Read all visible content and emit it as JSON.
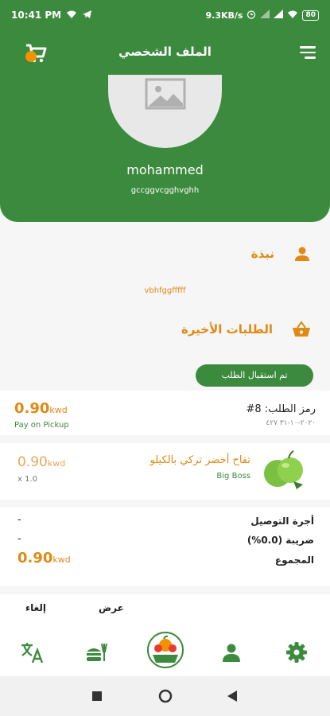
{
  "status_bar": {
    "time": "10:41 PM",
    "speed": "9.3KB/s",
    "battery": "80"
  },
  "header": {
    "title": "الملف الشخصي",
    "name": "mohammed",
    "subtitle": "gccggvcgghvghh"
  },
  "bio": {
    "title": "نبذة",
    "text": "vbhfggfffff"
  },
  "orders": {
    "title": "الطلبات الأخيرة",
    "status_label": "تم استقبال الطلب",
    "order_code_label": "رمز الطلب: 8#",
    "order_date": "٢٠٢٠-١٠-٣١ ٤٢٧",
    "total_value": "0.90",
    "currency": "kwd",
    "payment_method": "Pay on Pickup",
    "item": {
      "name": "تفاح أخضر تركي بالكيلو",
      "brand": "Big Boss",
      "price": "0.90",
      "currency": "kwd",
      "quantity": "x 1.0"
    },
    "summary": {
      "delivery_label": "أجرة التوصيل",
      "delivery_value": "-",
      "tax_label": "ضريبة (0.0%)",
      "tax_value": "-",
      "total_label": "المجموع",
      "total_value": "0.90",
      "currency": "kwd"
    }
  },
  "actions": {
    "view": "عرض",
    "cancel": "إلغاء"
  },
  "colors": {
    "primary_green": "#3c8a3e",
    "accent_orange": "#e08a14"
  }
}
